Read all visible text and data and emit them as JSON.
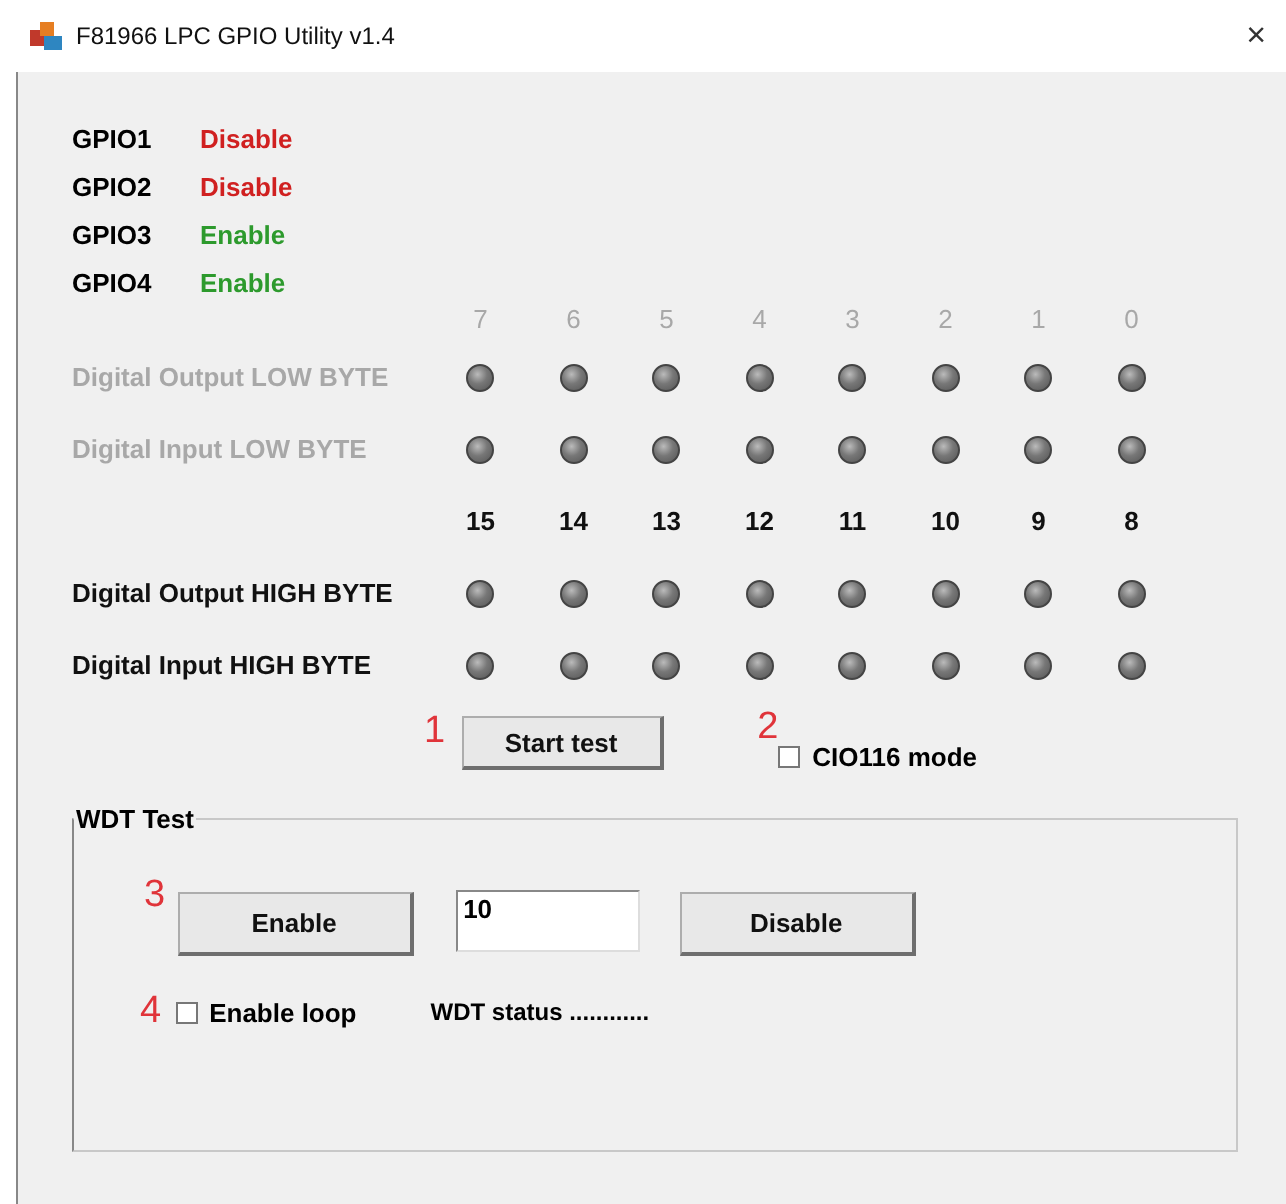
{
  "window": {
    "title": "F81966 LPC GPIO Utility v1.4",
    "close": "×"
  },
  "gpio": [
    {
      "name": "GPIO1",
      "status": "Disable",
      "enabled": false
    },
    {
      "name": "GPIO2",
      "status": "Disable",
      "enabled": false
    },
    {
      "name": "GPIO3",
      "status": "Enable",
      "enabled": true
    },
    {
      "name": "GPIO4",
      "status": "Enable",
      "enabled": true
    }
  ],
  "byte_groups": [
    {
      "disabled": true,
      "bits": [
        "7",
        "6",
        "5",
        "4",
        "3",
        "2",
        "1",
        "0"
      ],
      "rows": [
        {
          "label": "Digital Output LOW BYTE"
        },
        {
          "label": "Digital Input LOW BYTE"
        }
      ]
    },
    {
      "disabled": false,
      "bits": [
        "15",
        "14",
        "13",
        "12",
        "11",
        "10",
        "9",
        "8"
      ],
      "rows": [
        {
          "label": "Digital Output HIGH BYTE"
        },
        {
          "label": "Digital Input HIGH BYTE"
        }
      ]
    }
  ],
  "start_test": {
    "marker": "1",
    "label": "Start test"
  },
  "cio116": {
    "marker": "2",
    "label": "CIO116 mode",
    "checked": false
  },
  "wdt": {
    "title": "WDT Test",
    "marker_buttons": "3",
    "enable_button": "Enable",
    "timeout": "10",
    "disable_button": "Disable",
    "marker_loop": "4",
    "loop": {
      "label": "Enable loop",
      "checked": false
    },
    "status": "WDT status ............"
  }
}
